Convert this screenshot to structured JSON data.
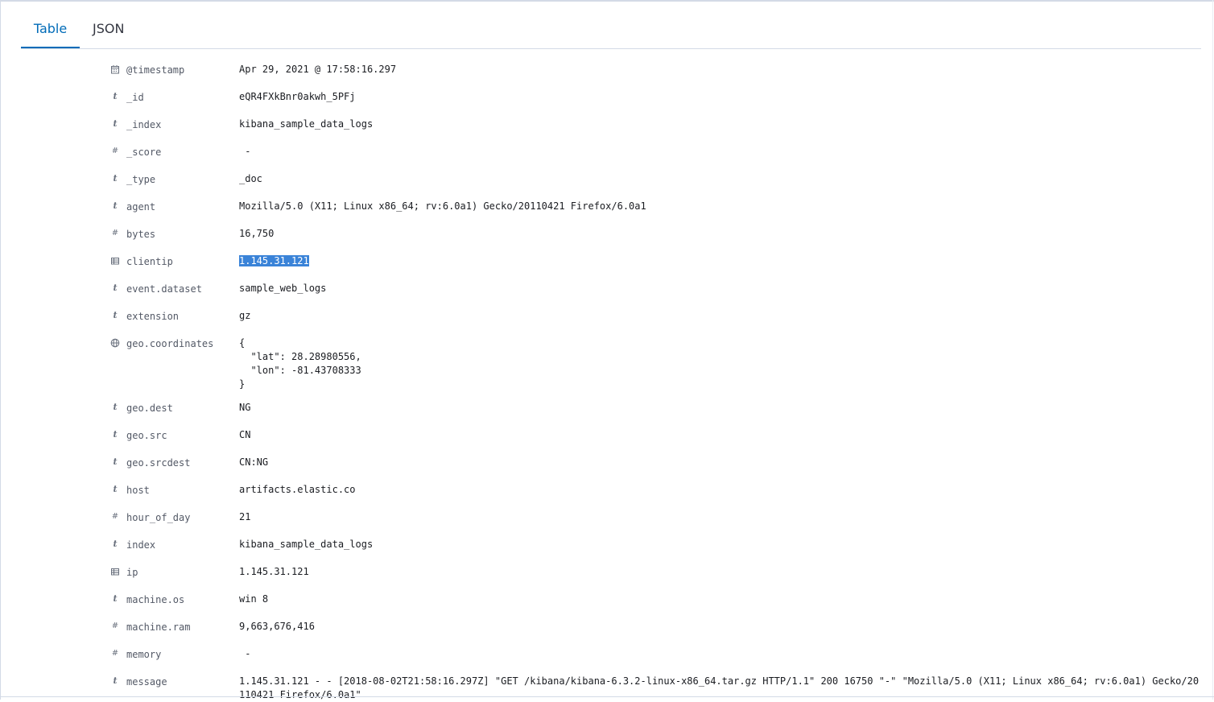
{
  "tabs": {
    "table": "Table",
    "json": "JSON"
  },
  "fields": [
    {
      "type": "date",
      "icon": "calendar-icon",
      "name": "@timestamp",
      "value": "Apr 29, 2021 @ 17:58:16.297"
    },
    {
      "type": "string",
      "icon": "string-type-icon",
      "name": "_id",
      "value": "eQR4FXkBnr0akwh_5PFj"
    },
    {
      "type": "string",
      "icon": "string-type-icon",
      "name": "_index",
      "value": "kibana_sample_data_logs"
    },
    {
      "type": "number",
      "icon": "number-type-icon",
      "name": "_score",
      "value": " -"
    },
    {
      "type": "string",
      "icon": "string-type-icon",
      "name": "_type",
      "value": "_doc"
    },
    {
      "type": "string",
      "icon": "string-type-icon",
      "name": "agent",
      "value": "Mozilla/5.0 (X11; Linux x86_64; rv:6.0a1) Gecko/20110421 Firefox/6.0a1"
    },
    {
      "type": "number",
      "icon": "number-type-icon",
      "name": "bytes",
      "value": "16,750"
    },
    {
      "type": "ip",
      "icon": "ip-type-icon",
      "name": "clientip",
      "value": "1.145.31.121",
      "selected": true
    },
    {
      "type": "string",
      "icon": "string-type-icon",
      "name": "event.dataset",
      "value": "sample_web_logs"
    },
    {
      "type": "string",
      "icon": "string-type-icon",
      "name": "extension",
      "value": "gz"
    },
    {
      "type": "geo",
      "icon": "globe-icon",
      "name": "geo.coordinates",
      "value": "{\n  \"lat\": 28.28980556,\n  \"lon\": -81.43708333\n}"
    },
    {
      "type": "string",
      "icon": "string-type-icon",
      "name": "geo.dest",
      "value": "NG"
    },
    {
      "type": "string",
      "icon": "string-type-icon",
      "name": "geo.src",
      "value": "CN"
    },
    {
      "type": "string",
      "icon": "string-type-icon",
      "name": "geo.srcdest",
      "value": "CN:NG"
    },
    {
      "type": "string",
      "icon": "string-type-icon",
      "name": "host",
      "value": "artifacts.elastic.co"
    },
    {
      "type": "number",
      "icon": "number-type-icon",
      "name": "hour_of_day",
      "value": "21"
    },
    {
      "type": "string",
      "icon": "string-type-icon",
      "name": "index",
      "value": "kibana_sample_data_logs"
    },
    {
      "type": "ip",
      "icon": "ip-type-icon",
      "name": "ip",
      "value": "1.145.31.121"
    },
    {
      "type": "string",
      "icon": "string-type-icon",
      "name": "machine.os",
      "value": "win 8"
    },
    {
      "type": "number",
      "icon": "number-type-icon",
      "name": "machine.ram",
      "value": "9,663,676,416"
    },
    {
      "type": "number",
      "icon": "number-type-icon",
      "name": "memory",
      "value": " -"
    },
    {
      "type": "string",
      "icon": "string-type-icon",
      "name": "message",
      "value": "1.145.31.121 - - [2018-08-02T21:58:16.297Z] \"GET /kibana/kibana-6.3.2-linux-x86_64.tar.gz HTTP/1.1\" 200 16750 \"-\" \"Mozilla/5.0 (X11; Linux x86_64; rv:6.0a1) Gecko/20110421 Firefox/6.0a1\""
    }
  ]
}
